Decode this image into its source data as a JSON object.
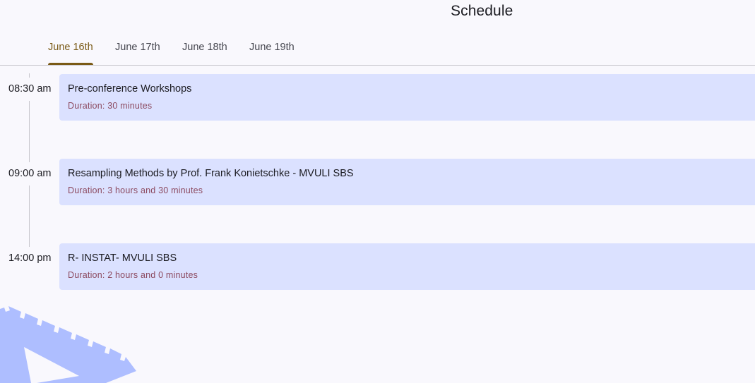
{
  "page": {
    "title": "Schedule"
  },
  "tabs": [
    {
      "label": "June 16th",
      "selected": true
    },
    {
      "label": "June 17th",
      "selected": false
    },
    {
      "label": "June 18th",
      "selected": false
    },
    {
      "label": "June 19th",
      "selected": false
    }
  ],
  "events": [
    {
      "time": "08:30 am",
      "title": "Pre-conference Workshops",
      "duration": "Duration: 30 minutes"
    },
    {
      "time": "09:00 am",
      "title": "Resampling Methods by Prof. Frank Konietschke - MVULI SBS",
      "duration": "Duration: 3 hours and 30 minutes"
    },
    {
      "time": "14:00 pm",
      "title": "R- INSTAT- MVULI SBS",
      "duration": "Duration: 2 hours and 0 minutes"
    }
  ],
  "colors": {
    "accent": "#7a5a16",
    "card_background": "#dbe1ff",
    "duration_text": "#8c4a60",
    "decoration": "#aebeff"
  },
  "decoration": {
    "icon": "set-square-ruler-icon"
  }
}
